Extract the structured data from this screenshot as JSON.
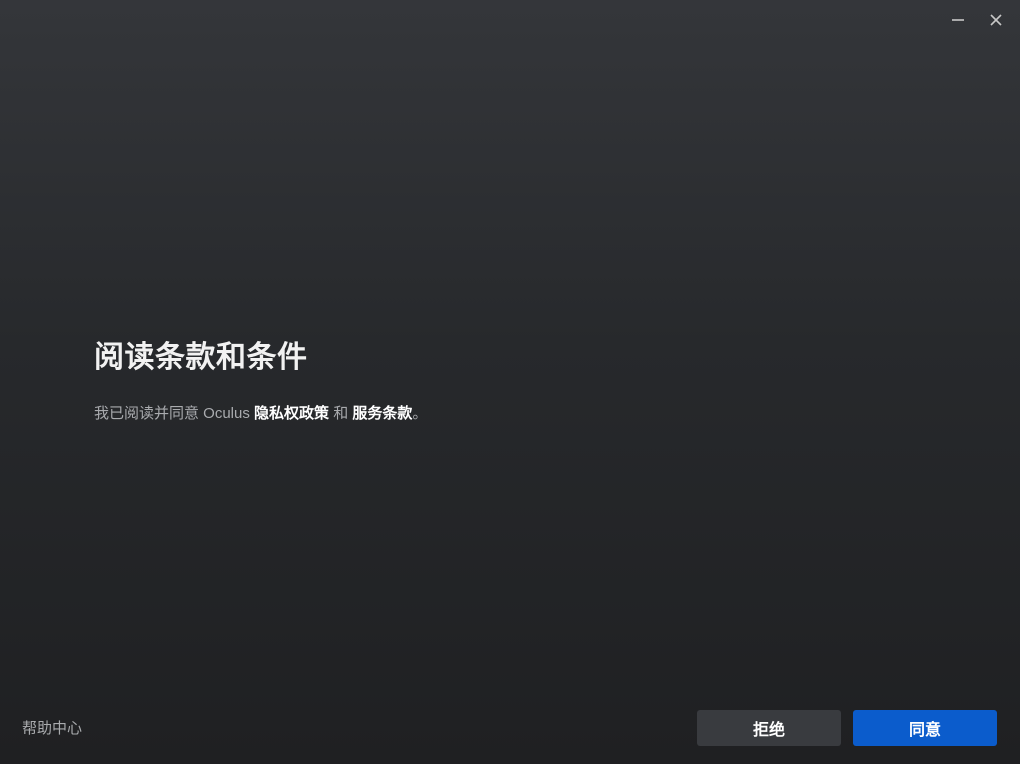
{
  "window": {
    "minimize_icon": "minimize-icon",
    "close_icon": "close-icon"
  },
  "main": {
    "title": "阅读条款和条件",
    "agreement": {
      "prefix": "我已阅读并同意 Oculus ",
      "privacy_policy": "隐私权政策",
      "conjunction": " 和 ",
      "terms_of_service": "服务条款",
      "suffix": "。"
    }
  },
  "footer": {
    "help_center": "帮助中心",
    "decline_label": "拒绝",
    "agree_label": "同意"
  },
  "colors": {
    "accent": "#0b5ccc",
    "secondary_button": "#393b3f",
    "background_top": "#34363a",
    "background_bottom": "#1f2022"
  }
}
